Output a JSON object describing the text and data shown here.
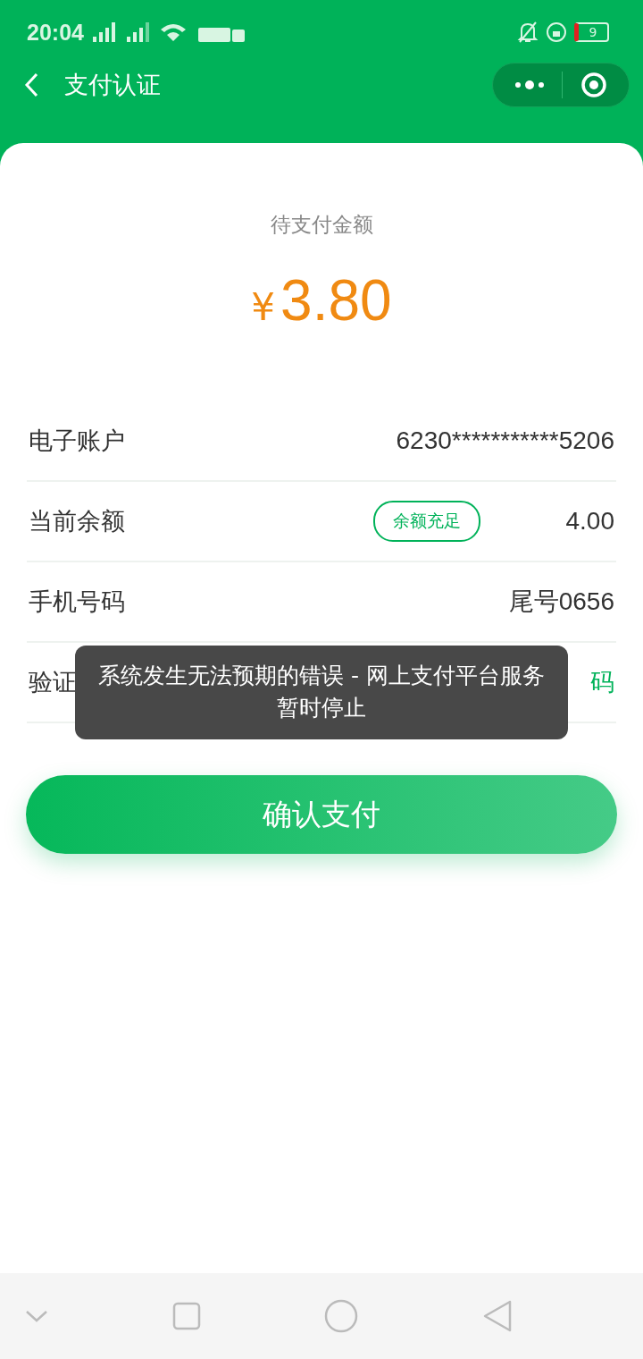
{
  "status_bar": {
    "time": "20:04",
    "battery": "9"
  },
  "nav": {
    "title": "支付认证"
  },
  "amount": {
    "label": "待支付金额",
    "currency": "¥",
    "value": "3.80"
  },
  "rows": [
    {
      "kind": "text",
      "label": "电子账户",
      "value": "6230***********5206"
    },
    {
      "kind": "badge",
      "label": "当前余额",
      "badge": "余额充足",
      "value": "4.00"
    },
    {
      "kind": "text",
      "label": "手机号码",
      "value": "尾号0656"
    },
    {
      "kind": "input",
      "label": "验证",
      "action": "码"
    }
  ],
  "confirm_button": "确认支付",
  "toast": "系统发生无法预期的错误 - 网上支付平台服务暂时停止"
}
